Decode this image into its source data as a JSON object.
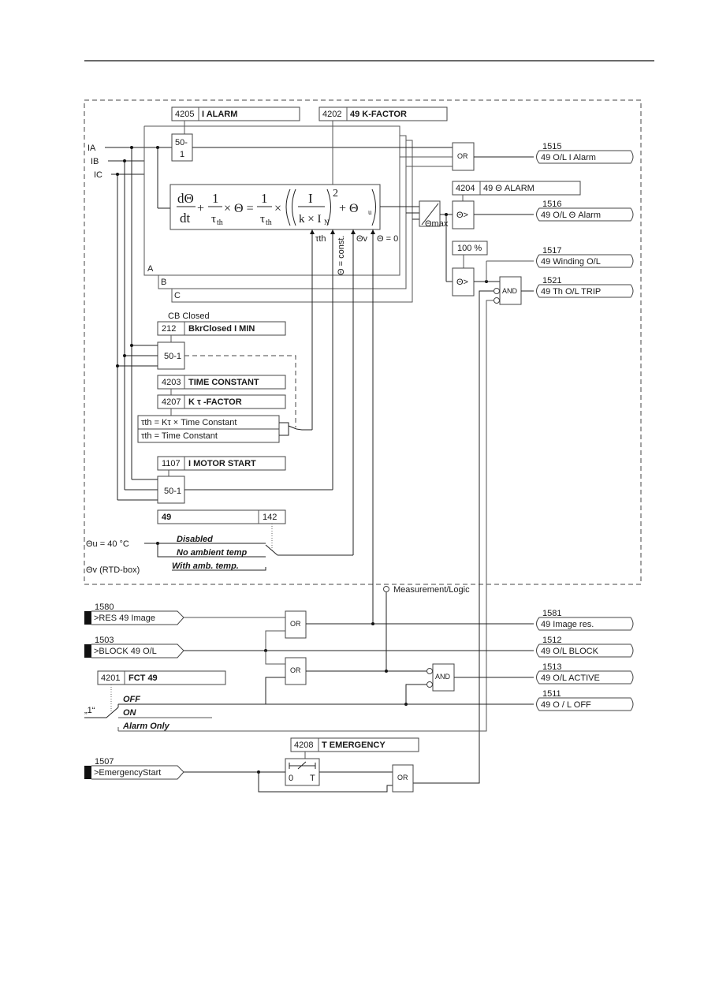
{
  "page": {
    "header_rule": true
  },
  "inputs": {
    "ia": "IA",
    "ib": "IB",
    "ic": "IC"
  },
  "params": {
    "i_alarm": {
      "addr": "4205",
      "name": "I ALARM"
    },
    "k_factor": {
      "addr": "4202",
      "name": "49 K-FACTOR"
    },
    "theta_alarm": {
      "addr": "4204",
      "name": "49 Θ ALARM"
    },
    "pct100": "100 %",
    "bkr_closed": {
      "addr": "212",
      "name": "BkrClosed I MIN"
    },
    "time_constant": {
      "addr": "4203",
      "name": "TIME CONSTANT"
    },
    "k_tau": {
      "addr": "4207",
      "name": "K τ -FACTOR"
    },
    "motor_start": {
      "addr": "1107",
      "name": "I MOTOR START"
    },
    "p49": {
      "name": "49",
      "addr": "142"
    },
    "fct49": {
      "addr": "4201",
      "name": "FCT 49"
    },
    "t_emergency": {
      "addr": "4208",
      "name": "T EMERGENCY"
    }
  },
  "blocks": {
    "b50_1_top_a": "50-",
    "b50_1_top_b": "1",
    "b50_1": "50-1",
    "or": "OR",
    "and": "AND",
    "theta_gt": "Θ>",
    "theta_max": "Θmax",
    "timer_0": "0",
    "timer_t": "T"
  },
  "equation": {
    "dtheta": "dΘ",
    "dt": "dt",
    "one": "1",
    "tau": "τ",
    "th": "th",
    "times_theta_eq": "× Θ =",
    "times": "×",
    "I": "I",
    "kIN": "k × I",
    "N": "N",
    "sq": "2",
    "plus_theta": "+ Θ",
    "u": "u",
    "plus": "+"
  },
  "labels": {
    "tau_th": "τth",
    "theta_const": "Θ = const.",
    "theta_v": "Θv",
    "theta_0": "Θ = 0",
    "phase_a": "A",
    "phase_b": "B",
    "phase_c": "C",
    "cb_closed": "CB Closed",
    "tau_opt1": "τth = Kτ × Time Constant",
    "tau_opt2": "τth = Time Constant",
    "theta_u": "Θu = 40 °C",
    "theta_v_rtd": "Θv (RTD-box)",
    "amb_disabled": "Disabled",
    "amb_no": "No ambient temp",
    "amb_with": "With amb. temp.",
    "meas_logic": "Measurement/Logic",
    "fct_off": "OFF",
    "fct_on": "ON",
    "fct_alarm": "Alarm Only",
    "one_quote": "„1“"
  },
  "outputs": [
    {
      "no": "1515",
      "label": "49 O/L I Alarm"
    },
    {
      "no": "1516",
      "label": "49 O/L  Θ  Alarm"
    },
    {
      "no": "1517",
      "label": "49 Winding O/L"
    },
    {
      "no": "1521",
      "label": "49 Th O/L TRIP"
    },
    {
      "no": "1581",
      "label": "49  Image res."
    },
    {
      "no": "1512",
      "label": "49 O/L BLOCK"
    },
    {
      "no": "1513",
      "label": "49 O/L ACTIVE"
    },
    {
      "no": "1511",
      "label": "49 O / L OFF"
    }
  ],
  "binary_inputs": [
    {
      "no": "1580",
      "label": ">RES 49 Image"
    },
    {
      "no": "1503",
      "label": ">BLOCK 49 O/L"
    },
    {
      "no": "1507",
      "label": ">EmergencyStart"
    }
  ]
}
